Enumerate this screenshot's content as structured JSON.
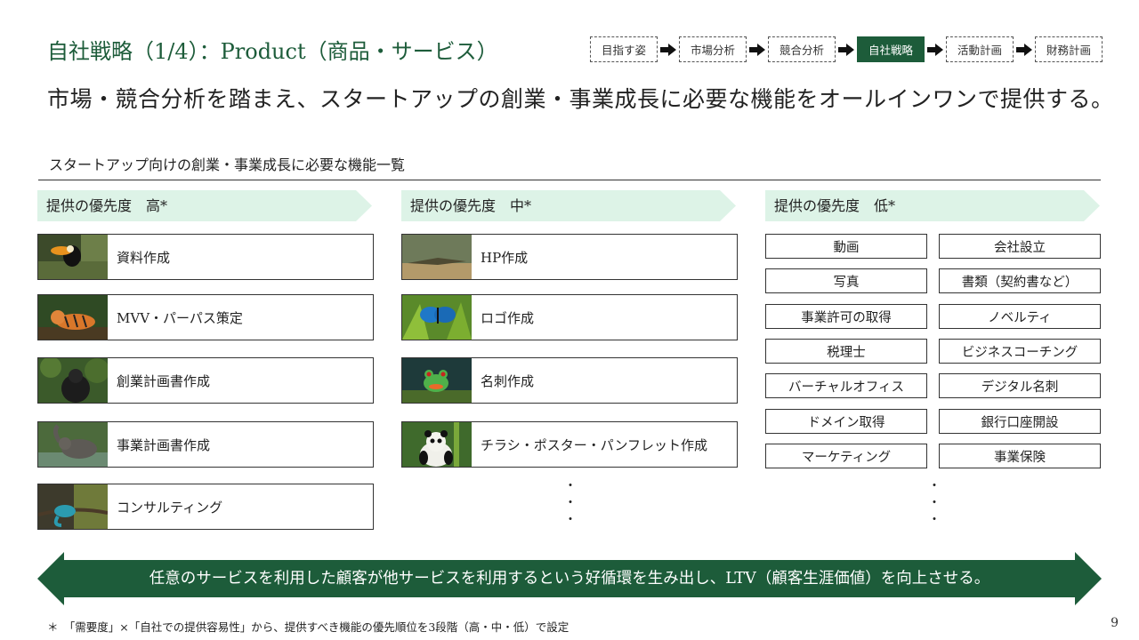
{
  "header": {
    "title": "自社戦略（1/4）：Product（商品・サービス）",
    "steps": [
      {
        "label": "目指す姿",
        "active": false
      },
      {
        "label": "市場分析",
        "active": false
      },
      {
        "label": "競合分析",
        "active": false
      },
      {
        "label": "自社戦略",
        "active": true
      },
      {
        "label": "活動計画",
        "active": false
      },
      {
        "label": "財務計画",
        "active": false
      }
    ]
  },
  "headline": "市場・競合分析を踏まえ、スタートアップの創業・事業成長に必要な機能をオールインワンで提供する。",
  "subheading": "スタートアップ向けの創業・事業成長に必要な機能一覧",
  "colors": {
    "brand_green": "#1d5c3a",
    "band_mint": "#ddf3e7"
  },
  "columns": {
    "high": {
      "label": "提供の優先度　高*",
      "items": [
        {
          "label": "資料作成",
          "icon": "toucan-photo"
        },
        {
          "label": "MVV・パーパス策定",
          "icon": "tiger-photo"
        },
        {
          "label": "創業計画書作成",
          "icon": "gorilla-photo"
        },
        {
          "label": "事業計画書作成",
          "icon": "elephant-photo"
        },
        {
          "label": "コンサルティング",
          "icon": "chameleon-photo"
        }
      ]
    },
    "mid": {
      "label": "提供の優先度　中*",
      "items": [
        {
          "label": "HP作成",
          "icon": "crocodile-photo"
        },
        {
          "label": "ロゴ作成",
          "icon": "butterfly-photo"
        },
        {
          "label": "名刺作成",
          "icon": "frog-photo"
        },
        {
          "label": "チラシ・ポスター・パンフレット作成",
          "icon": "panda-photo"
        }
      ],
      "ellipsis": [
        "・",
        "・",
        "・"
      ]
    },
    "low": {
      "label": "提供の優先度　低*",
      "items": [
        "動画",
        "会社設立",
        "写真",
        "書類（契約書など）",
        "事業許可の取得",
        "ノベルティ",
        "税理士",
        "ビジネスコーチング",
        "バーチャルオフィス",
        "デジタル名刺",
        "ドメイン取得",
        "銀行口座開設",
        "マーケティング",
        "事業保険"
      ],
      "ellipsis": [
        "・",
        "・",
        "・"
      ]
    }
  },
  "banner": "任意のサービスを利用した顧客が他サービスを利用するという好循環を生み出し、LTV（顧客生涯価値）を向上させる。",
  "footnote": "＊　「需要度」×「自社での提供容易性」から、提供すべき機能の優先順位を3段階（高・中・低）で設定",
  "page_number": "9"
}
